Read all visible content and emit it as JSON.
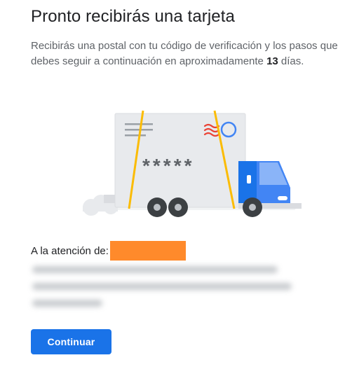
{
  "header": {
    "title": "Pronto recibirás una tarjeta"
  },
  "description": {
    "text_before": "Recibirás una postal con tu código de verificación y los pasos que debes seguir a continuación en aproximadamente ",
    "days_number": "13",
    "text_after": " días."
  },
  "illustration": {
    "code_mask": "*****",
    "colors": {
      "card": "#e8eaed",
      "strap": "#fbbc04",
      "truck_blue": "#4285f4",
      "truck_dark_blue": "#1a73e8",
      "stamp_blue": "#4285f4",
      "stamp_red": "#ea4335",
      "wheel": "#3c4043"
    }
  },
  "recipient": {
    "label": "A la atención de:",
    "redaction_color": "#ff8a2b"
  },
  "actions": {
    "continue_label": "Continuar"
  },
  "colors": {
    "primary": "#1a73e8",
    "text_primary": "#202124",
    "text_secondary": "#5f6368"
  }
}
